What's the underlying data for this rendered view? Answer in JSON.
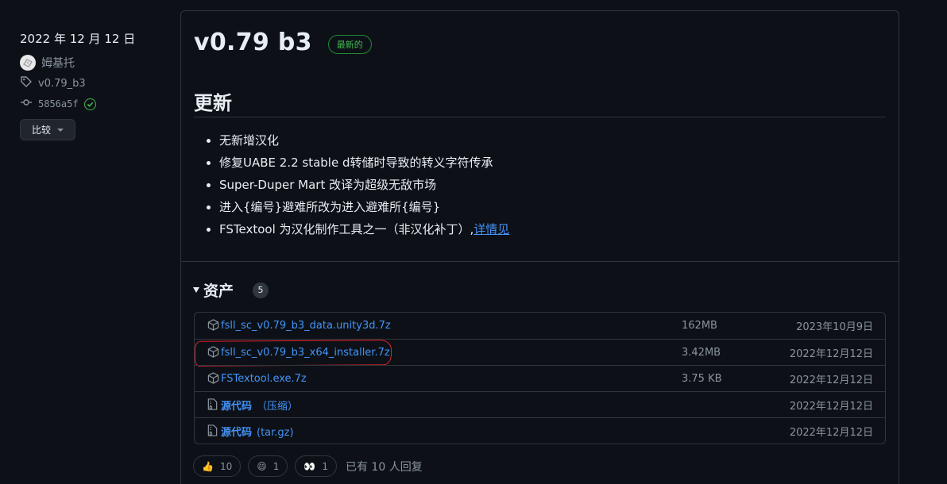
{
  "meta": {
    "date": "2022 年 12 月 12 日",
    "author": "姆基托",
    "tag": "v0.79_b3",
    "commit": "5856a5f",
    "compare_label": "比较"
  },
  "release": {
    "title": "v0.79 b3",
    "badge": "最新的",
    "section_title": "更新",
    "notes": [
      "无新增汉化",
      "修复UABE 2.2 stable d转储时导致的转义字符传承",
      "Super-Duper Mart 改译为超级无敌市场",
      "进入{编号}避难所改为进入避难所{编号}",
      "FSTextool 为汉化制作工具之一（非汉化补丁）,"
    ],
    "notes_link": "详情见"
  },
  "assets": {
    "title": "资产",
    "count": "5",
    "items": [
      {
        "name": "fsll_sc_v0.79_b3_data.unity3d.7z",
        "size": "162MB",
        "date": "2023年10月9日"
      },
      {
        "name": "fsll_sc_v0.79_b3_x64_installer.7z",
        "size": "3.42MB",
        "date": "2022年12月12日"
      },
      {
        "name": "FSTextool.exe.7z",
        "size": "3.75 KB",
        "date": "2022年12月12日"
      },
      {
        "name": "源代码",
        "sub": "（压缩）",
        "size": "",
        "date": "2022年12月12日"
      },
      {
        "name": "源代码",
        "sub": "(tar.gz)",
        "size": "",
        "date": "2022年12月12日"
      }
    ]
  },
  "reactions": {
    "thumbs_up": "10",
    "smile": "1",
    "eyes": "1",
    "reply_text": "已有 10 人回复"
  },
  "colors": {
    "background": "#0d1117",
    "link": "#4493f8",
    "latest_green": "#3fb950",
    "annotation_red": "#e0202a"
  }
}
